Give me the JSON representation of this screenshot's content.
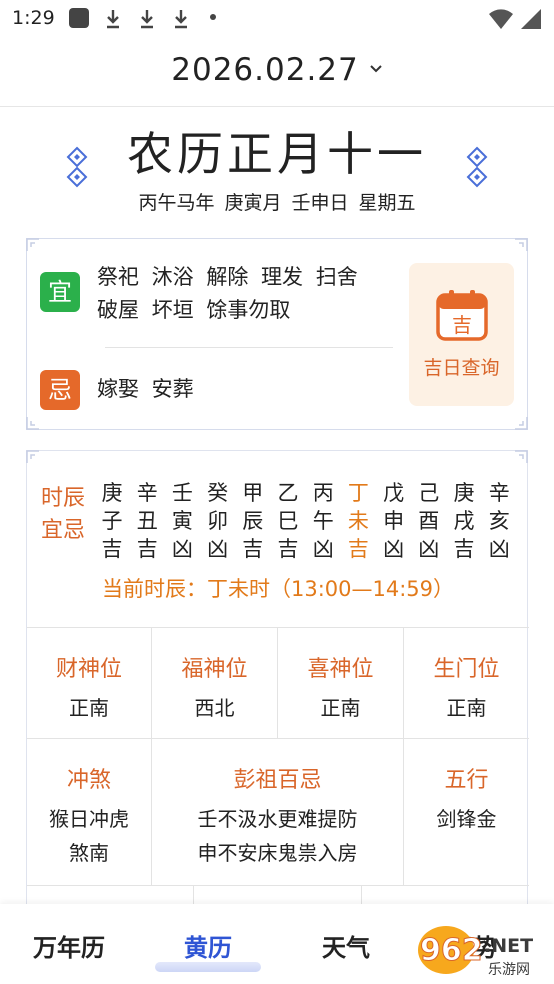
{
  "status_bar": {
    "time": "1:29"
  },
  "header": {
    "date": "2026.02.27",
    "chevron": "chevron-down-icon"
  },
  "lunar": {
    "title": "农历正月十一",
    "subtitle": "丙午马年  庚寅月  壬申日  星期五"
  },
  "yi_ji": {
    "yi_badge": "宜",
    "yi_line1": "祭祀  沐浴  解除  理发  扫舍",
    "yi_line2": "破屋  坏垣  馀事勿取",
    "ji_badge": "忌",
    "ji_text": "嫁娶  安葬",
    "jiri_label": "吉日查询"
  },
  "shichen": {
    "title_line1": "时辰",
    "title_line2": "宜忌",
    "columns": [
      {
        "stem": "庚",
        "branch": "子",
        "luck": "吉"
      },
      {
        "stem": "辛",
        "branch": "丑",
        "luck": "吉"
      },
      {
        "stem": "壬",
        "branch": "寅",
        "luck": "凶"
      },
      {
        "stem": "癸",
        "branch": "卯",
        "luck": "凶"
      },
      {
        "stem": "甲",
        "branch": "辰",
        "luck": "吉"
      },
      {
        "stem": "乙",
        "branch": "巳",
        "luck": "吉"
      },
      {
        "stem": "丙",
        "branch": "午",
        "luck": "凶"
      },
      {
        "stem": "丁",
        "branch": "未",
        "luck": "吉"
      },
      {
        "stem": "戊",
        "branch": "申",
        "luck": "凶"
      },
      {
        "stem": "己",
        "branch": "酉",
        "luck": "凶"
      },
      {
        "stem": "庚",
        "branch": "戌",
        "luck": "吉"
      },
      {
        "stem": "辛",
        "branch": "亥",
        "luck": "凶"
      }
    ],
    "current_index": 7,
    "current_label": "当前时辰：丁未时（13:00—14:59）"
  },
  "gods": {
    "caishen": {
      "title": "财神位",
      "value": "正南"
    },
    "fushen": {
      "title": "福神位",
      "value": "西北"
    },
    "xishen": {
      "title": "喜神位",
      "value": "正南"
    },
    "shengmen": {
      "title": "生门位",
      "value": "正南"
    }
  },
  "details": {
    "chongsha": {
      "title": "冲煞",
      "line1": "猴日冲虎",
      "line2": "煞南"
    },
    "pengzu": {
      "title": "彭祖百忌",
      "line1": "壬不汲水更难提防",
      "line2": "申不安床鬼祟入房"
    },
    "wuxing": {
      "title": "五行",
      "value": "剑锋金"
    }
  },
  "nav": {
    "items": [
      "万年历",
      "黄历",
      "天气",
      "运势"
    ],
    "active_index": 1
  },
  "watermark": {
    "text": "962.NET",
    "sub": "乐游网"
  },
  "colors": {
    "accent": "#d9662a",
    "active": "#2f55d4",
    "yi": "#2bb04b",
    "ji": "#e5692a"
  }
}
